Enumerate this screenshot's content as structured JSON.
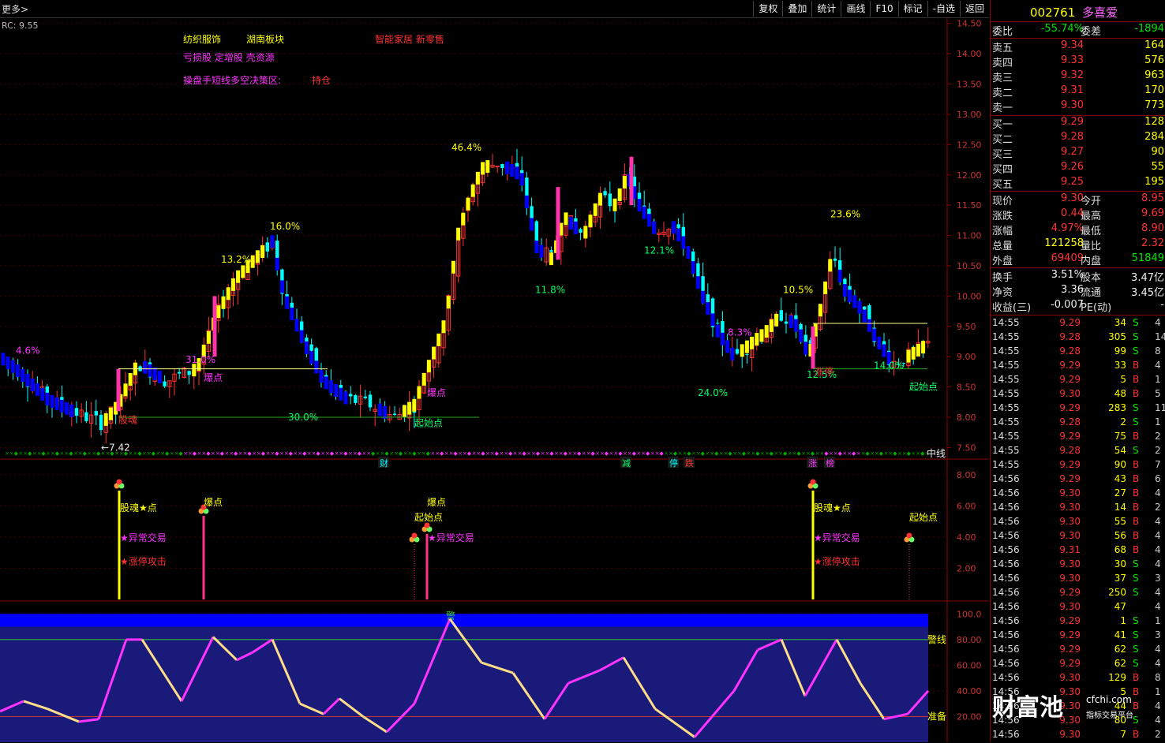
{
  "topbar": {
    "more": "更多>",
    "buttons": [
      "复权",
      "叠加",
      "统计",
      "画线",
      "F10",
      "标记",
      "-自选",
      "返回"
    ]
  },
  "rc_label": "RC: 9.55",
  "chart_data": [
    {
      "type": "candlestick",
      "title": "",
      "price_axis": [
        "14.50",
        "14.00",
        "13.50",
        "13.00",
        "12.50",
        "12.00",
        "11.50",
        "11.00",
        "10.50",
        "10.00",
        "9.50",
        "9.00",
        "8.50",
        "8.00",
        "7.50"
      ],
      "ylim": [
        7.35,
        14.6
      ],
      "annotations": [
        "4.6%",
        "16.0%",
        "13.2%",
        "31.0%",
        "30.0%",
        "46.4%",
        "11.8%",
        "12.1%",
        "8.3%",
        "24.0%",
        "10.5%",
        "23.6%",
        "12.5%",
        "14.0%",
        "←7.42"
      ],
      "signal_labels": [
        "股魂",
        "爆点",
        "爆点",
        "起始点",
        "起始点",
        "涨停",
        "中线"
      ],
      "header_texts": [
        "纺织服饰",
        "湖南板块",
        "智能家居 新零售",
        "亏损股 定增股 壳资源",
        "操盘手短线多空决策区:",
        "持仓"
      ],
      "bottom_markers": [
        "财",
        "减",
        "停",
        "跌",
        "涨",
        "榜"
      ]
    },
    {
      "type": "bar",
      "title": "",
      "price_axis": [
        "8.00",
        "6.00",
        "4.00",
        "2.00"
      ],
      "labels": [
        "股魂★点",
        "★异常交易",
        "★涨停攻击",
        "爆点",
        "爆点",
        "起始点",
        "★异常交易",
        "股魂★点",
        "★异常交易",
        "★涨停攻击",
        "起始点"
      ]
    },
    {
      "type": "line",
      "title": "",
      "price_axis": [
        "100.0",
        "80.00",
        "60.00",
        "40.00",
        "20.00"
      ],
      "ylim": [
        0,
        110
      ],
      "reference_lines": [
        {
          "label": "警线",
          "value": 80
        },
        {
          "label": "准备",
          "value": 20
        }
      ],
      "top_label": "警"
    }
  ],
  "panel": {
    "code": "002761",
    "name": "多喜爱",
    "weibi_label": "委比",
    "weibi": "-55.74%",
    "weicha_label": "委差",
    "weicha": "-1894",
    "asks": [
      {
        "label": "卖五",
        "price": "9.34",
        "vol": "164"
      },
      {
        "label": "卖四",
        "price": "9.33",
        "vol": "576"
      },
      {
        "label": "卖三",
        "price": "9.32",
        "vol": "963"
      },
      {
        "label": "卖二",
        "price": "9.31",
        "vol": "170"
      },
      {
        "label": "卖一",
        "price": "9.30",
        "vol": "773"
      }
    ],
    "bids": [
      {
        "label": "买一",
        "price": "9.29",
        "vol": "128"
      },
      {
        "label": "买二",
        "price": "9.28",
        "vol": "284"
      },
      {
        "label": "买三",
        "price": "9.27",
        "vol": "90"
      },
      {
        "label": "买四",
        "price": "9.26",
        "vol": "55"
      },
      {
        "label": "买五",
        "price": "9.25",
        "vol": "195"
      }
    ],
    "stats": [
      {
        "l1": "现价",
        "v1": "9.30",
        "c1": "red",
        "l2": "今开",
        "v2": "8.95",
        "c2": "red"
      },
      {
        "l1": "涨跌",
        "v1": "0.44",
        "c1": "red",
        "l2": "最高",
        "v2": "9.69",
        "c2": "red"
      },
      {
        "l1": "涨幅",
        "v1": "4.97%",
        "c1": "red",
        "l2": "最低",
        "v2": "8.90",
        "c2": "red"
      },
      {
        "l1": "总量",
        "v1": "121258",
        "c1": "yellow",
        "l2": "量比",
        "v2": "2.32",
        "c2": "red"
      },
      {
        "l1": "外盘",
        "v1": "69409",
        "c1": "red",
        "l2": "内盘",
        "v2": "51849",
        "c2": "green"
      }
    ],
    "stats2": [
      {
        "l1": "换手",
        "v1": "3.51%",
        "l2": "股本",
        "v2": "3.47亿"
      },
      {
        "l1": "净资",
        "v1": "3.36",
        "l2": "流通",
        "v2": "3.45亿"
      },
      {
        "l1": "收益(三)",
        "v1": "-0.007",
        "l2": "PE(动)",
        "v2": "-"
      }
    ],
    "ticks": [
      {
        "t": "14:55",
        "p": "9.29",
        "v": "34",
        "bs": "S",
        "n": "4"
      },
      {
        "t": "14:55",
        "p": "9.28",
        "v": "305",
        "bs": "S",
        "n": "14"
      },
      {
        "t": "14:55",
        "p": "9.28",
        "v": "99",
        "bs": "S",
        "n": "8"
      },
      {
        "t": "14:55",
        "p": "9.29",
        "v": "33",
        "bs": "B",
        "n": "4"
      },
      {
        "t": "14:55",
        "p": "9.29",
        "v": "5",
        "bs": "B",
        "n": "1"
      },
      {
        "t": "14:55",
        "p": "9.30",
        "v": "48",
        "bs": "B",
        "n": "5"
      },
      {
        "t": "14:55",
        "p": "9.29",
        "v": "283",
        "bs": "S",
        "n": "11"
      },
      {
        "t": "14:55",
        "p": "9.28",
        "v": "2",
        "bs": "S",
        "n": "1"
      },
      {
        "t": "14:55",
        "p": "9.29",
        "v": "75",
        "bs": "B",
        "n": "2"
      },
      {
        "t": "14:55",
        "p": "9.28",
        "v": "54",
        "bs": "S",
        "n": "2"
      },
      {
        "t": "14:55",
        "p": "9.29",
        "v": "90",
        "bs": "B",
        "n": "7"
      },
      {
        "t": "14:56",
        "p": "9.29",
        "v": "43",
        "bs": "B",
        "n": "6"
      },
      {
        "t": "14:56",
        "p": "9.30",
        "v": "27",
        "bs": "B",
        "n": "4"
      },
      {
        "t": "14:56",
        "p": "9.30",
        "v": "14",
        "bs": "B",
        "n": "2"
      },
      {
        "t": "14:56",
        "p": "9.30",
        "v": "55",
        "bs": "B",
        "n": "4"
      },
      {
        "t": "14:56",
        "p": "9.30",
        "v": "56",
        "bs": "B",
        "n": "4"
      },
      {
        "t": "14:56",
        "p": "9.31",
        "v": "68",
        "bs": "B",
        "n": "4"
      },
      {
        "t": "14:56",
        "p": "9.30",
        "v": "30",
        "bs": "S",
        "n": "4"
      },
      {
        "t": "14:56",
        "p": "9.30",
        "v": "37",
        "bs": "S",
        "n": "3"
      },
      {
        "t": "14:56",
        "p": "9.29",
        "v": "250",
        "bs": "S",
        "n": "4"
      },
      {
        "t": "14:56",
        "p": "9.30",
        "v": "47",
        "bs": "",
        "n": "4"
      },
      {
        "t": "14:56",
        "p": "9.29",
        "v": "1",
        "bs": "S",
        "n": "1"
      },
      {
        "t": "14:56",
        "p": "9.29",
        "v": "41",
        "bs": "S",
        "n": "3"
      },
      {
        "t": "14:56",
        "p": "9.29",
        "v": "62",
        "bs": "S",
        "n": "4"
      },
      {
        "t": "14:56",
        "p": "9.29",
        "v": "62",
        "bs": "S",
        "n": "4"
      },
      {
        "t": "14:56",
        "p": "9.30",
        "v": "129",
        "bs": "B",
        "n": "8"
      },
      {
        "t": "14:56",
        "p": "9.30",
        "v": "5",
        "bs": "B",
        "n": "1"
      },
      {
        "t": "14:56",
        "p": "9.30",
        "v": "44",
        "bs": "B",
        "n": "4"
      },
      {
        "t": "14:56",
        "p": "9.30",
        "v": "80",
        "bs": "S",
        "n": "4"
      },
      {
        "t": "14:56",
        "p": "9.30",
        "v": "7",
        "bs": "B",
        "n": "2"
      }
    ]
  },
  "watermark": {
    "main": "财富池",
    "site": "cfchi.com",
    "sub": "指标交易平台"
  },
  "colors": {
    "up": "#ff3232",
    "down": "#00ffff",
    "yellow": "#ffff00",
    "blue": "#0000ff",
    "magenta": "#ff33ff"
  }
}
